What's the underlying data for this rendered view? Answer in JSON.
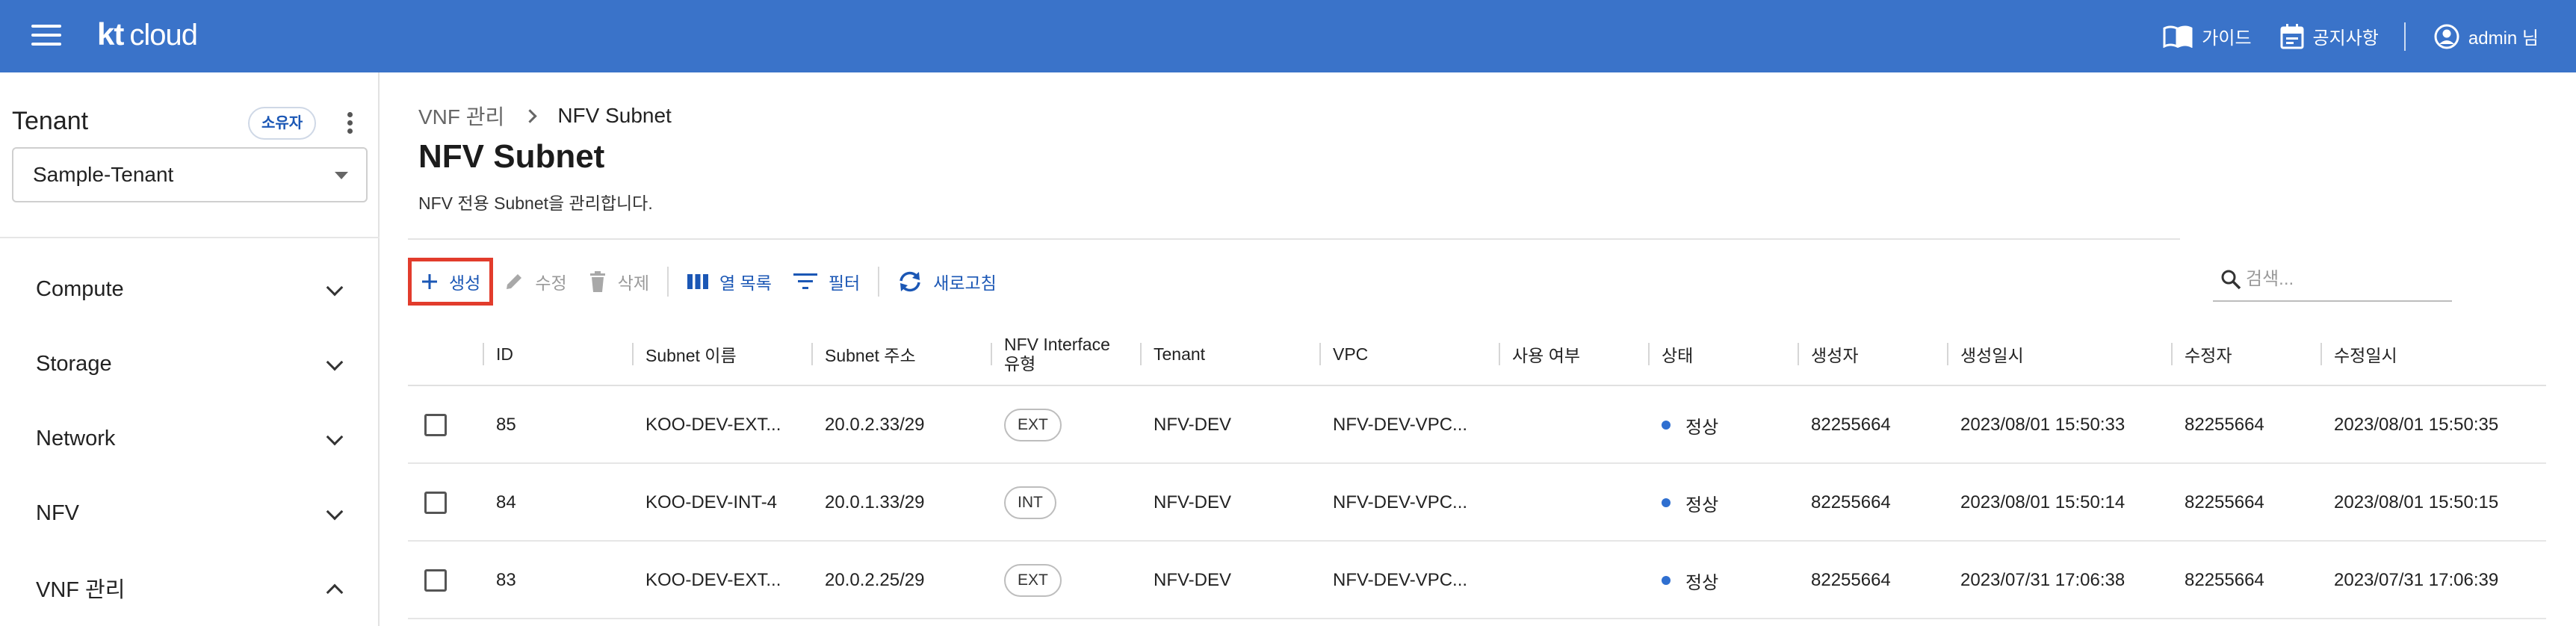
{
  "topbar": {
    "logo_kt": "kt",
    "logo_cloud": "cloud",
    "guide_label": "가이드",
    "notice_label": "공지사항",
    "user_label": "admin 님"
  },
  "sidebar": {
    "tenant_title": "Tenant",
    "owner_badge": "소유자",
    "tenant_selected": "Sample-Tenant",
    "items": [
      {
        "label": "Compute",
        "expanded": false
      },
      {
        "label": "Storage",
        "expanded": false
      },
      {
        "label": "Network",
        "expanded": false
      },
      {
        "label": "NFV",
        "expanded": false
      },
      {
        "label": "VNF 관리",
        "expanded": true
      }
    ]
  },
  "main": {
    "breadcrumb": [
      "VNF 관리",
      "NFV Subnet"
    ],
    "title": "NFV Subnet",
    "description": "NFV 전용 Subnet을 관리합니다.",
    "toolbar": {
      "create": "생성",
      "edit": "수정",
      "delete": "삭제",
      "columns": "열 목록",
      "filter": "필터",
      "refresh": "새로고침"
    },
    "search_placeholder": "검색...",
    "columns": [
      "ID",
      "Subnet 이름",
      "Subnet 주소",
      "NFV Interface\n유형",
      "Tenant",
      "VPC",
      "사용 여부",
      "상태",
      "생성자",
      "생성일시",
      "수정자",
      "수정일시"
    ],
    "rows": [
      {
        "id": "85",
        "name": "KOO-DEV-EXT...",
        "addr": "20.0.2.33/29",
        "type": "EXT",
        "tenant": "NFV-DEV",
        "vpc": "NFV-DEV-VPC...",
        "use": "",
        "status": "정상",
        "creator": "82255664",
        "created": "2023/08/01 15:50:33",
        "modifier": "82255664",
        "modified": "2023/08/01 15:50:35"
      },
      {
        "id": "84",
        "name": "KOO-DEV-INT-4",
        "addr": "20.0.1.33/29",
        "type": "INT",
        "tenant": "NFV-DEV",
        "vpc": "NFV-DEV-VPC...",
        "use": "",
        "status": "정상",
        "creator": "82255664",
        "created": "2023/08/01 15:50:14",
        "modifier": "82255664",
        "modified": "2023/08/01 15:50:15"
      },
      {
        "id": "83",
        "name": "KOO-DEV-EXT...",
        "addr": "20.0.2.25/29",
        "type": "EXT",
        "tenant": "NFV-DEV",
        "vpc": "NFV-DEV-VPC...",
        "use": "",
        "status": "정상",
        "creator": "82255664",
        "created": "2023/07/31 17:06:38",
        "modifier": "82255664",
        "modified": "2023/07/31 17:06:39"
      }
    ]
  },
  "colors": {
    "topbar": "#3a73c9",
    "accent": "#1b57b5",
    "highlight": "#e23c2c",
    "status_ok": "#2f6fd0"
  },
  "icons": [
    "menu-icon",
    "book-icon",
    "calendar-icon",
    "account-icon",
    "kebab-icon",
    "plus-icon",
    "pencil-icon",
    "trash-icon",
    "columns-icon",
    "filter-icon",
    "refresh-icon",
    "search-icon"
  ]
}
